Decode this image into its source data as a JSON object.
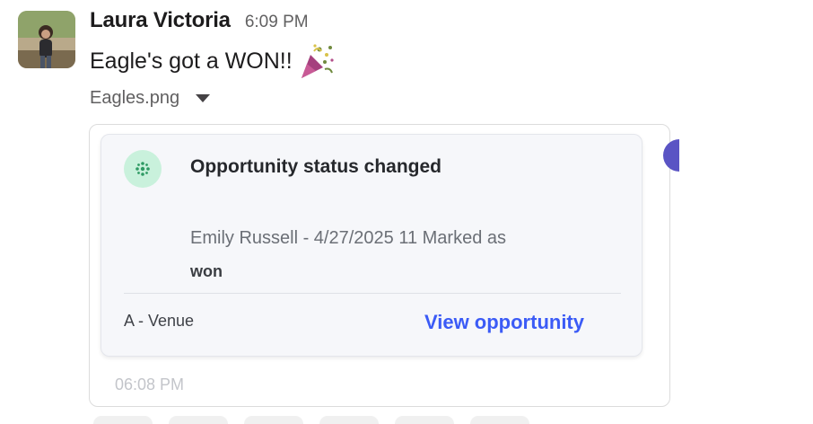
{
  "message": {
    "author": "Laura Victoria",
    "timestamp": "6:09 PM",
    "text": "Eagle's got a WON!!",
    "emoji": "party-popper-icon"
  },
  "file": {
    "name": "Eagles.png"
  },
  "card": {
    "title": "Opportunity status changed",
    "description": "Emily Russell - 4/27/2025 11 Marked as",
    "status": "won",
    "footer_label": "A - Venue",
    "link_label": "View opportunity",
    "time": "06:08 PM",
    "icon": "sparkle-icon"
  },
  "colors": {
    "link": "#3b5bf6",
    "icon_bg": "#c9f1dc",
    "icon_fg": "#2e9a63",
    "side_avatar": "#5a54c4"
  }
}
